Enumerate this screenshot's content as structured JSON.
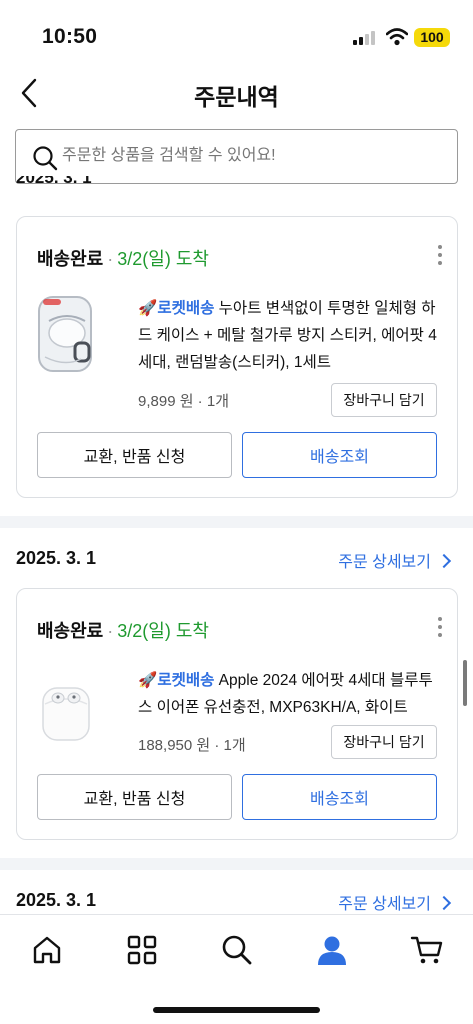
{
  "status_bar": {
    "time": "10:50",
    "battery": "100"
  },
  "header": {
    "title": "주문내역",
    "back_icon": "chevron-left-icon"
  },
  "search": {
    "placeholder": "주문한 상품을 검색할 수 있어요!",
    "icon": "search-icon"
  },
  "cut_off_date": "2025. 3. 1",
  "orders": [
    {
      "status": "배송완료",
      "arrival": "3/2(일) 도착",
      "badge": "로켓배송",
      "product_name": "누아트 변색없이 투명한 일체형 하드 케이스 + 메탈 철가루 방지 스티커, 에어팟 4세대, 랜덤발송(스티커), 1세트",
      "price": "9,899 원",
      "quantity": "1개",
      "cart_label": "장바구니 담기",
      "exchange_label": "교환, 반품 신청",
      "track_label": "배송조회"
    },
    {
      "date": "2025. 3. 1",
      "detail_link": "주문 상세보기",
      "status": "배송완료",
      "arrival": "3/2(일) 도착",
      "badge": "로켓배송",
      "product_name": "Apple 2024 에어팟 4세대 블루투스 이어폰 유선충전, MXP63KH/A, 화이트",
      "price": "188,950 원",
      "quantity": "1개",
      "cart_label": "장바구니 담기",
      "exchange_label": "교환, 반품 신청",
      "track_label": "배송조회"
    }
  ],
  "next_group": {
    "date": "2025. 3. 1",
    "detail_link": "주문 상세보기"
  },
  "bottom_nav": [
    "home-icon",
    "category-grid-icon",
    "search-icon",
    "my-account-icon",
    "cart-icon"
  ],
  "colors": {
    "accent": "#2f6fe0",
    "arrival": "#1f9a2f",
    "battery": "#f5d90a"
  }
}
